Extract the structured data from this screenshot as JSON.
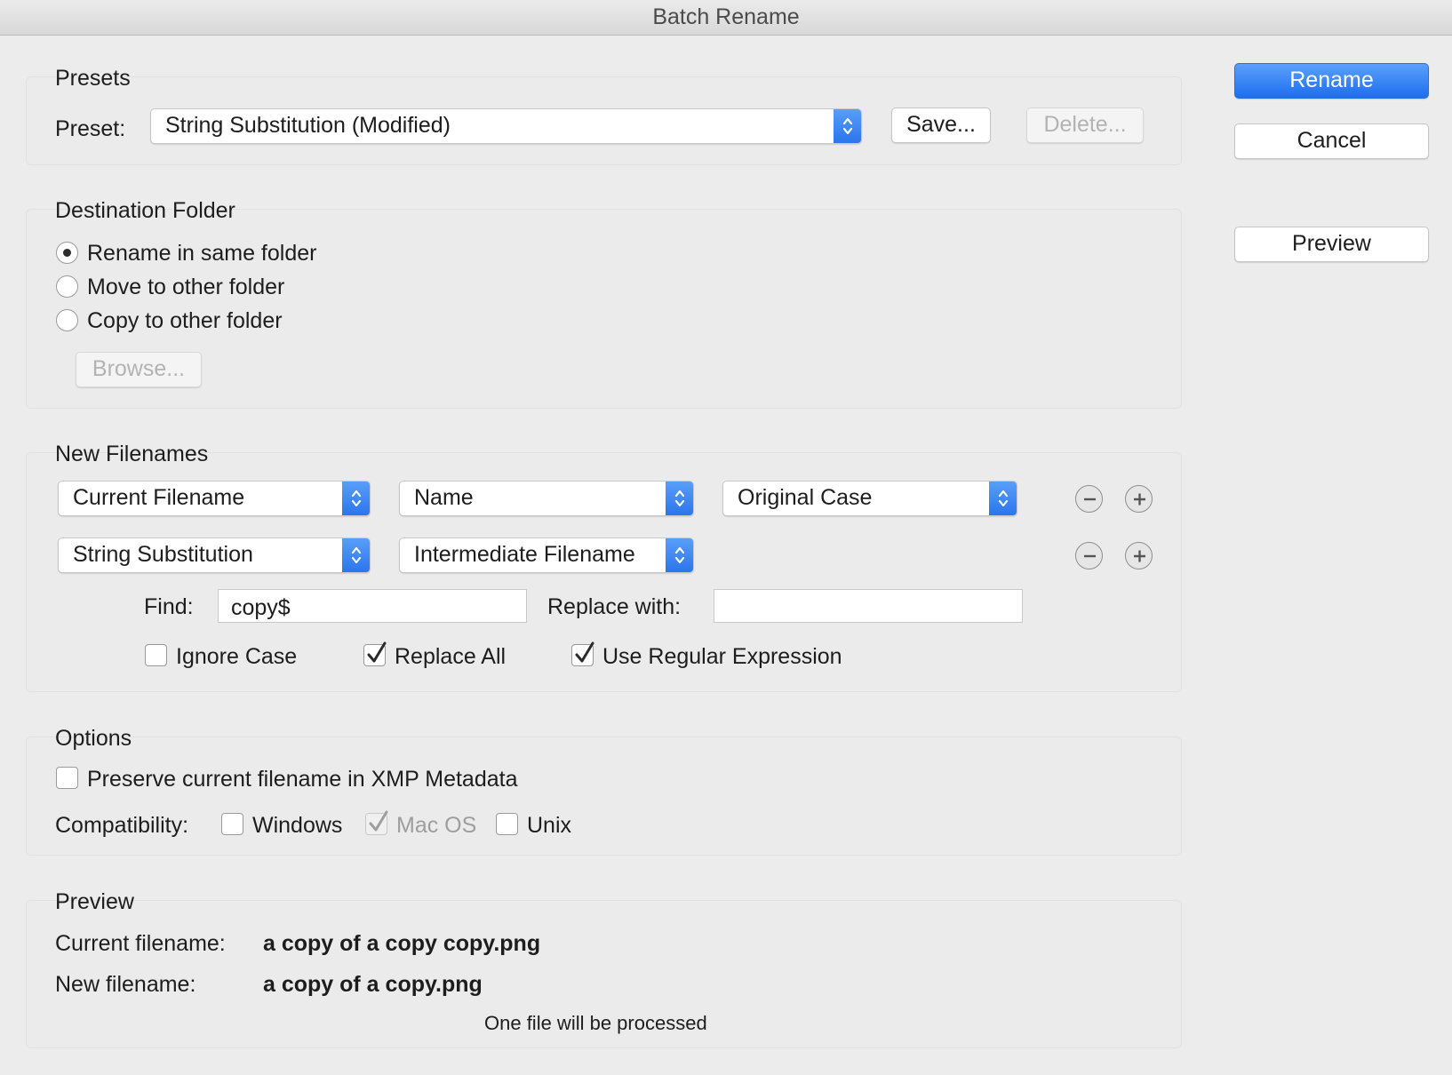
{
  "window": {
    "title": "Batch Rename"
  },
  "actions": {
    "rename": "Rename",
    "cancel": "Cancel",
    "preview": "Preview"
  },
  "presets": {
    "title": "Presets",
    "preset_label": "Preset:",
    "preset_value": "String Substitution (Modified)",
    "save": "Save...",
    "delete": "Delete..."
  },
  "destination": {
    "title": "Destination Folder",
    "options": [
      "Rename in same folder",
      "Move to other folder",
      "Copy to other folder"
    ],
    "selected": "Rename in same folder",
    "browse": "Browse..."
  },
  "new_filenames": {
    "title": "New Filenames",
    "row1": [
      "Current Filename",
      "Name",
      "Original Case"
    ],
    "row2": [
      "String Substitution",
      "Intermediate Filename"
    ],
    "find_label": "Find:",
    "find_value": "copy$",
    "replace_label": "Replace with:",
    "replace_value": "",
    "ignore_case": {
      "label": "Ignore Case",
      "checked": false
    },
    "replace_all": {
      "label": "Replace All",
      "checked": true
    },
    "use_regex": {
      "label": "Use Regular Expression",
      "checked": true
    }
  },
  "options": {
    "title": "Options",
    "preserve": {
      "label": "Preserve current filename in XMP Metadata",
      "checked": false
    },
    "compat_label": "Compatibility:",
    "windows": {
      "label": "Windows",
      "checked": false
    },
    "macos": {
      "label": "Mac OS",
      "checked": true,
      "disabled": true
    },
    "unix": {
      "label": "Unix",
      "checked": false
    }
  },
  "preview": {
    "title": "Preview",
    "current_label": "Current filename:",
    "current_value": "a copy of a copy copy.png",
    "new_label": "New filename:",
    "new_value": "a copy of a copy.png",
    "status": "One file will be processed"
  },
  "colors": {
    "accent": "#2a74ee",
    "background": "#ececec"
  },
  "icons": [
    "stepper-icon",
    "minus-icon",
    "plus-icon",
    "checkmark-icon"
  ]
}
